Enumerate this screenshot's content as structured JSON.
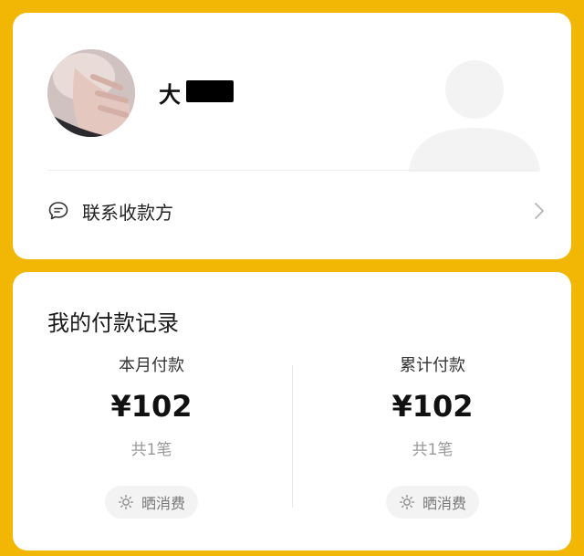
{
  "payee": {
    "name": "大",
    "contact_label": "联系收款方"
  },
  "records": {
    "title": "我的付款记录",
    "this_month": {
      "label": "本月付款",
      "amount": "¥102",
      "count": "共1笔",
      "share_label": "晒消费"
    },
    "total": {
      "label": "累计付款",
      "amount": "¥102",
      "count": "共1笔",
      "share_label": "晒消费"
    }
  },
  "colors": {
    "background": "#f2b705",
    "card": "#ffffff",
    "muted_text": "#999999"
  },
  "icons": [
    "avatar-photo",
    "person-silhouette-icon",
    "chat-bubble-icon",
    "chevron-right-icon",
    "sun-icon"
  ]
}
